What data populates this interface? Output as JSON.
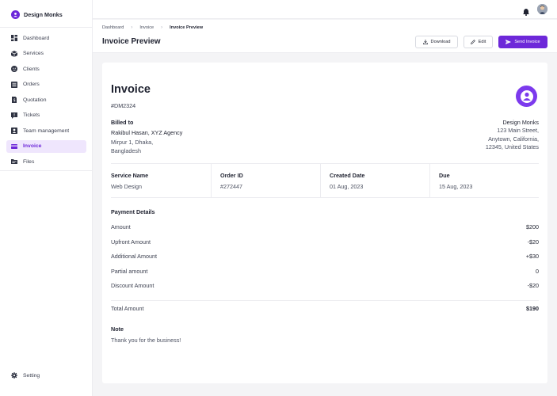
{
  "brand": {
    "name": "Design Monks"
  },
  "sidebar": {
    "items": [
      {
        "label": "Dashboard",
        "icon": "dashboard-icon",
        "active": false
      },
      {
        "label": "Services",
        "icon": "box-icon",
        "active": false
      },
      {
        "label": "Clients",
        "icon": "smiley-icon",
        "active": false
      },
      {
        "label": "Orders",
        "icon": "list-icon",
        "active": false
      },
      {
        "label": "Quotation",
        "icon": "quote-file-icon",
        "active": false
      },
      {
        "label": "Tickets",
        "icon": "ticket-icon",
        "active": false
      },
      {
        "label": "Team management",
        "icon": "team-icon",
        "active": false
      },
      {
        "label": "Invoice",
        "icon": "invoice-icon",
        "active": true
      },
      {
        "label": "Files",
        "icon": "folder-icon",
        "active": false
      }
    ],
    "setting_label": "Setting"
  },
  "breadcrumb": {
    "items": [
      "Dashboard",
      "Invoice",
      "Invoice Preview"
    ]
  },
  "header": {
    "title": "Invoice Preview",
    "download_label": "Download",
    "edit_label": "Edit",
    "send_label": "Send Invoice"
  },
  "invoice": {
    "title": "Invoice",
    "number": "#DM2324",
    "billed_to_label": "Billed to",
    "billed_to_name": "Rakibul Hasan, XYZ Agency",
    "billed_to_address_line1": "Mirpur 1, Dhaka,",
    "billed_to_address_line2": "Bangladesh",
    "from_name": "Design Monks",
    "from_address_line1": "123 Main Street,",
    "from_address_line2": "Anytown, California,",
    "from_address_line3": "12345, United States",
    "meta": [
      {
        "label": "Service Name",
        "value": "Web Design"
      },
      {
        "label": "Order ID",
        "value": "#272447"
      },
      {
        "label": "Created Date",
        "value": "01 Aug, 2023"
      },
      {
        "label": "Due",
        "value": "15 Aug, 2023"
      }
    ],
    "payment_title": "Payment Details",
    "payments": [
      {
        "label": "Amount",
        "value": "$200"
      },
      {
        "label": "Upfront Amount",
        "value": "-$20"
      },
      {
        "label": "Additional Amount",
        "value": "+$30"
      },
      {
        "label": "Partial amount",
        "value": "0"
      },
      {
        "label": "Discount Amount",
        "value": "-$20"
      }
    ],
    "total_label": "Total Amount",
    "total_value": "$190",
    "note_label": "Note",
    "note_text": "Thank you for the business!"
  },
  "colors": {
    "accent": "#6d28d9",
    "active_bg": "#efe6fd",
    "page_bg": "#f4f4f6"
  }
}
